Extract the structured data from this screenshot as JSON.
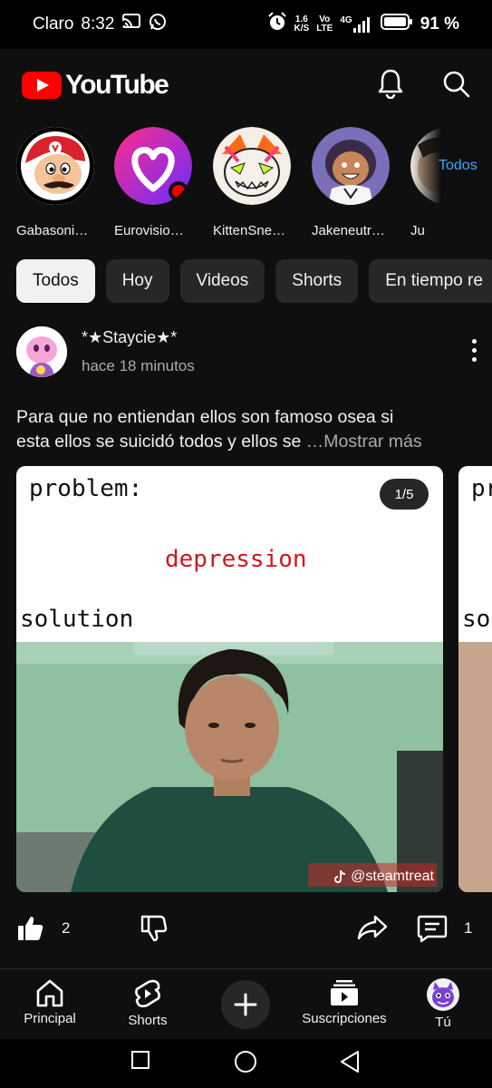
{
  "status_bar": {
    "carrier": "Claro",
    "time": "8:32",
    "net_speed_value": "1.6",
    "net_speed_unit": "K/S",
    "network_top": "Vo",
    "network_bottom": "LTE",
    "network_gen": "4G",
    "battery": "91 %"
  },
  "header": {
    "logo_text": "YouTube",
    "notifications_icon": "bell-icon",
    "search_icon": "search-icon"
  },
  "subscriptions": {
    "items": [
      {
        "name": "Gabasoni…"
      },
      {
        "name": "Eurovisio…",
        "live": true
      },
      {
        "name": "KittenSne…"
      },
      {
        "name": "Jakeneutr…"
      },
      {
        "name": "Ju"
      }
    ],
    "all_link": "Todos"
  },
  "chips": [
    {
      "label": "Todos",
      "active": true
    },
    {
      "label": "Hoy"
    },
    {
      "label": "Videos"
    },
    {
      "label": "Shorts"
    },
    {
      "label": "En tiempo re"
    }
  ],
  "post": {
    "author": "*★Staycie★*",
    "time_ago": "hace 18 minutos",
    "text_line1": "Para que no entiendan ellos son famoso osea si",
    "text_line2": "esta ellos se suicidó todos y ellos se",
    "more_label": "…Mostrar más",
    "image": {
      "counter": "1/5",
      "problem_label": "problem:",
      "depression_label": "depression",
      "solution_label": "solution",
      "watermark": "@steamtreat",
      "next_problem": "pr",
      "next_solution": "sol"
    },
    "likes": "2",
    "comments": "1"
  },
  "bottom_nav": {
    "home": "Principal",
    "shorts": "Shorts",
    "subscriptions": "Suscripciones",
    "you": "Tú"
  },
  "colors": {
    "background": "#0f0f0f",
    "chip": "#272727",
    "accent_red": "#ff0000",
    "link_blue": "#3ea6ff",
    "meme_red": "#d0161d"
  }
}
